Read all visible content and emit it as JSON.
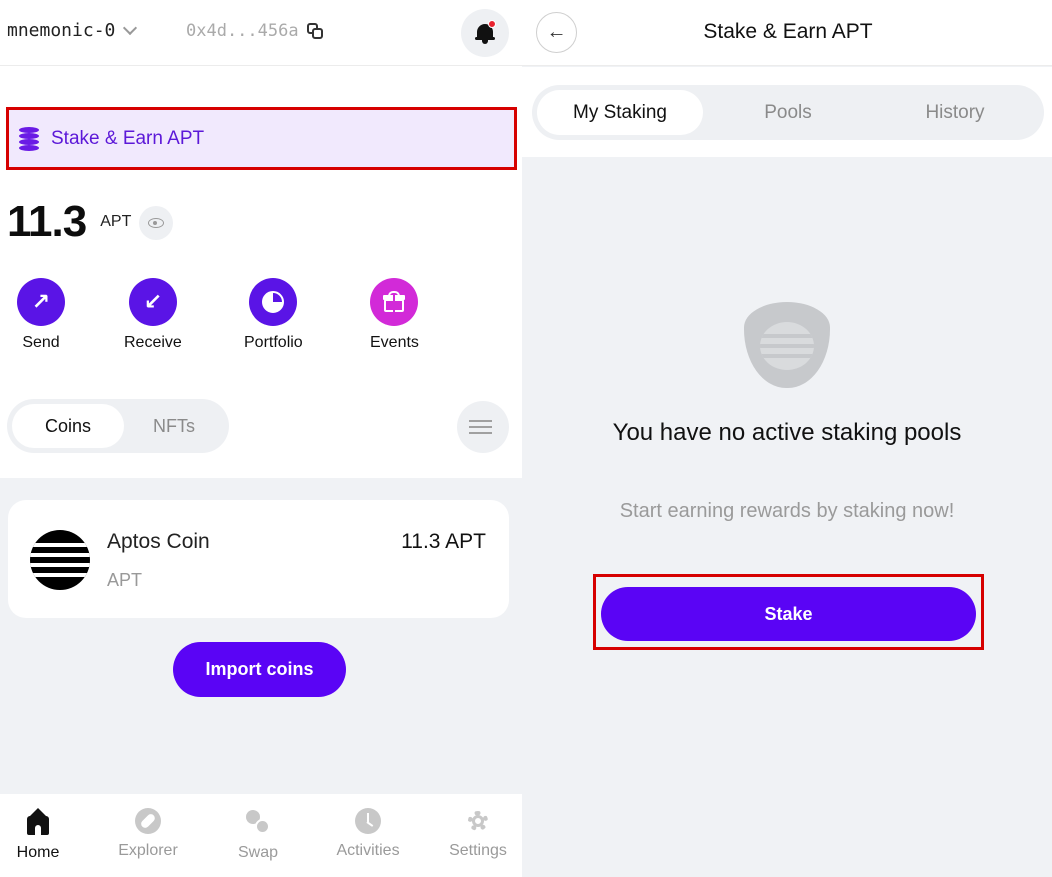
{
  "wallet": {
    "account_name": "mnemonic-0",
    "address": "0x4d...456a"
  },
  "stake_banner": {
    "label": "Stake & Earn APT"
  },
  "balance": {
    "amount": "11.3",
    "unit": "APT"
  },
  "actions": [
    {
      "label": "Send"
    },
    {
      "label": "Receive"
    },
    {
      "label": "Portfolio"
    },
    {
      "label": "Events"
    }
  ],
  "asset_tabs": {
    "coins": "Coins",
    "nfts": "NFTs",
    "active": "Coins"
  },
  "coins": [
    {
      "name": "Aptos Coin",
      "symbol": "APT",
      "amount": "11.3 APT"
    }
  ],
  "import_button": "Import coins",
  "bottom_nav": [
    {
      "label": "Home",
      "icon": "home-icon",
      "active": true
    },
    {
      "label": "Explorer",
      "icon": "compass-icon",
      "active": false
    },
    {
      "label": "Swap",
      "icon": "swap-icon",
      "active": false
    },
    {
      "label": "Activities",
      "icon": "clock-icon",
      "active": false
    },
    {
      "label": "Settings",
      "icon": "gear-icon",
      "active": false
    }
  ],
  "staking_page": {
    "title": "Stake & Earn APT",
    "tabs": [
      {
        "label": "My Staking",
        "active": true
      },
      {
        "label": "Pools",
        "active": false
      },
      {
        "label": "History",
        "active": false
      }
    ],
    "empty_title": "You have no active staking pools",
    "empty_subtitle": "Start earning rewards by staking now!",
    "stake_button": "Stake"
  },
  "colors": {
    "primary": "#5a04f5",
    "highlight_outline": "#d60000",
    "banner_bg": "#f1e9fd",
    "events_accent": "#d22ad8",
    "notification_dot": "#e8222e"
  }
}
